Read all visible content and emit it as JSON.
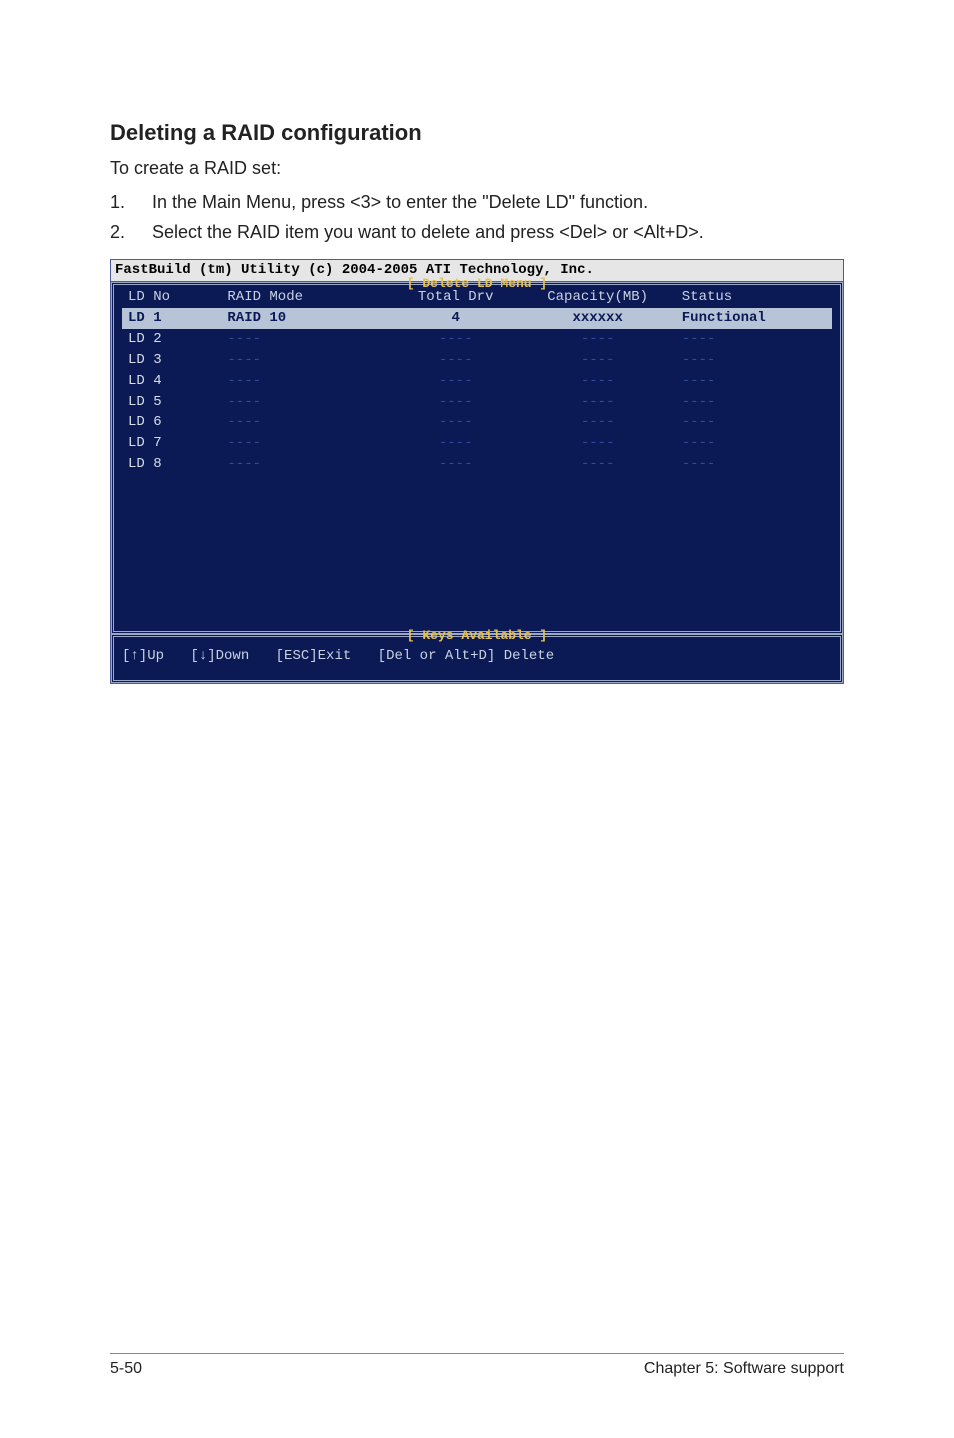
{
  "heading": "Deleting a RAID configuration",
  "intro": "To create a RAID set:",
  "steps": [
    "In the Main Menu, press <3> to enter the \"Delete LD\" function.",
    "Select the RAID item you want to delete and press <Del> or <Alt+D>."
  ],
  "bios": {
    "title": "FastBuild (tm) Utility (c) 2004-2005 ATI Technology, Inc.",
    "menu_label": "[ Delete LD Menu ]",
    "keys_label": "[ Keys Available ]",
    "columns": {
      "ld": "LD No",
      "mode": "RAID Mode",
      "drv": "Total Drv",
      "cap": "Capacity(MB)",
      "status": "Status"
    },
    "rows": [
      {
        "ld": "LD 1",
        "mode": "RAID 10",
        "drv": "4",
        "cap": "xxxxxx",
        "status": "Functional",
        "selected": true
      },
      {
        "ld": "LD 2",
        "mode": "----",
        "drv": "----",
        "cap": "----",
        "status": "----",
        "selected": false
      },
      {
        "ld": "LD 3",
        "mode": "----",
        "drv": "----",
        "cap": "----",
        "status": "----",
        "selected": false
      },
      {
        "ld": "LD 4",
        "mode": "----",
        "drv": "----",
        "cap": "----",
        "status": "----",
        "selected": false
      },
      {
        "ld": "LD 5",
        "mode": "----",
        "drv": "----",
        "cap": "----",
        "status": "----",
        "selected": false
      },
      {
        "ld": "LD 6",
        "mode": "----",
        "drv": "----",
        "cap": "----",
        "status": "----",
        "selected": false
      },
      {
        "ld": "LD 7",
        "mode": "----",
        "drv": "----",
        "cap": "----",
        "status": "----",
        "selected": false
      },
      {
        "ld": "LD 8",
        "mode": "----",
        "drv": "----",
        "cap": "----",
        "status": "----",
        "selected": false
      }
    ],
    "keys": {
      "up": "[↑]Up",
      "down": "[↓]Down",
      "exit": "[ESC]Exit",
      "del": "[Del or Alt+D] Delete"
    }
  },
  "footer": {
    "left": "5-50",
    "right": "Chapter 5: Software support"
  }
}
